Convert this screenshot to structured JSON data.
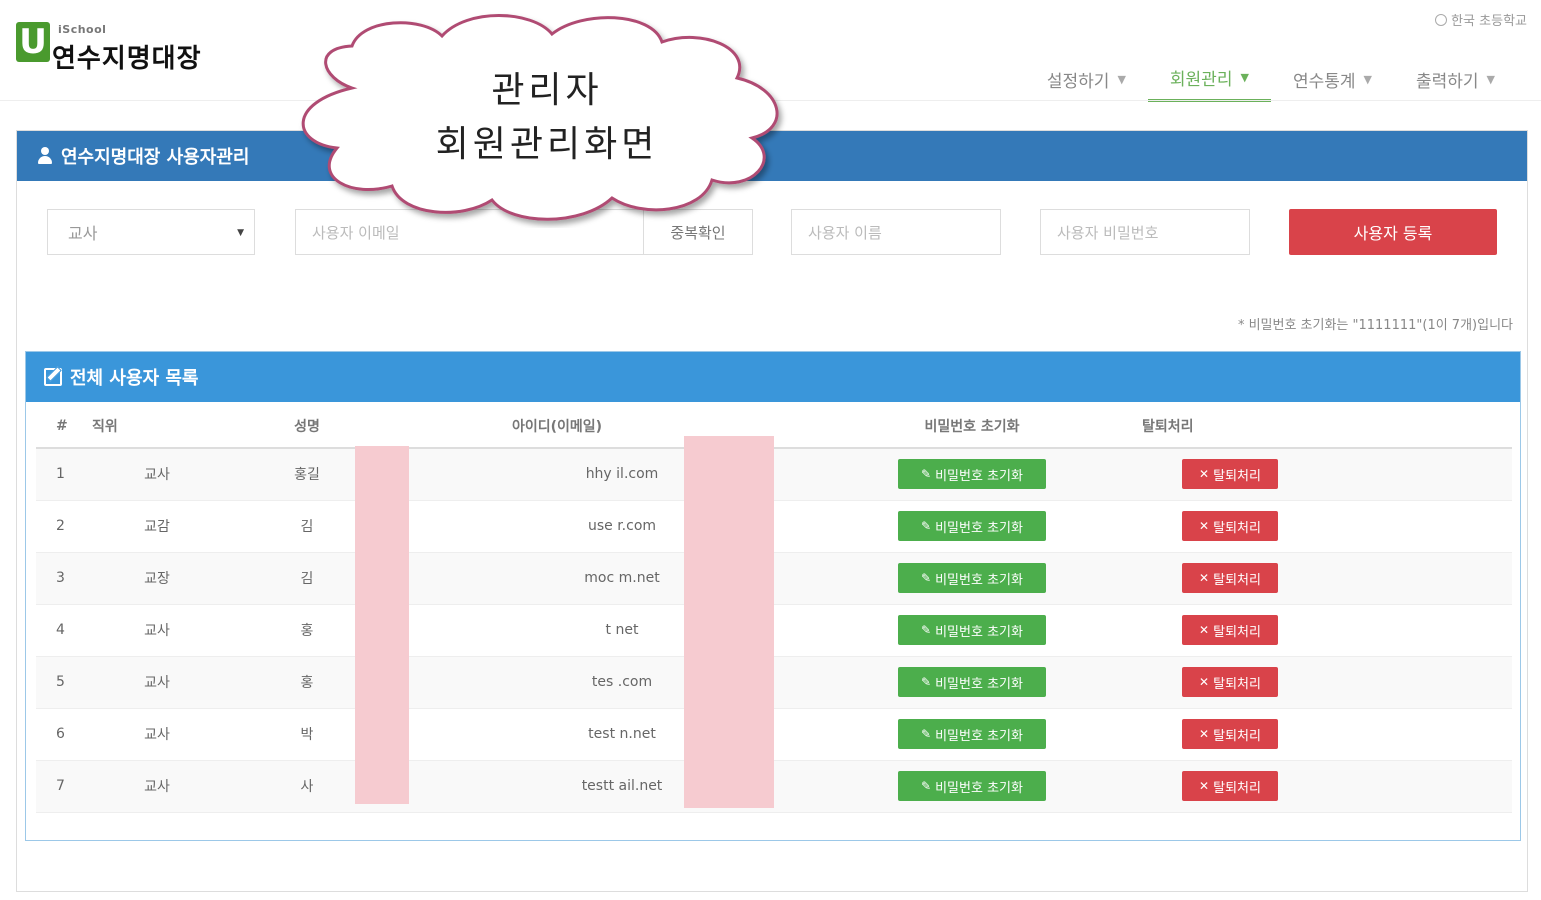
{
  "header": {
    "logo_small": "iSchool",
    "logo_letter": "U",
    "logo_title": "연수지명대장",
    "school_name": "한국 초등학교",
    "nav": [
      {
        "label": "설정하기",
        "active": false
      },
      {
        "label": "회원관리",
        "active": true
      },
      {
        "label": "연수통계",
        "active": false
      },
      {
        "label": "출력하기",
        "active": false
      }
    ]
  },
  "callout": {
    "line1": "관리자",
    "line2": "회원관리화면"
  },
  "user_panel": {
    "title": "연수지명대장 사용자관리",
    "position_select": "교사",
    "email_placeholder": "사용자 이메일",
    "dup_check_label": "중복확인",
    "name_placeholder": "사용자 이름",
    "password_placeholder": "사용자 비밀번호",
    "register_label": "사용자 등록",
    "note": "* 비밀번호 초기화는 \"1111111\"(1이 7개)입니다"
  },
  "list_panel": {
    "title": "전체 사용자 목록",
    "columns": {
      "num": "#",
      "position": "직위",
      "name": "성명",
      "id": "아이디(이메일)",
      "reset": "비밀번호 초기화",
      "leave": "탈퇴처리"
    },
    "reset_button_label": "비밀번호 초기화",
    "leave_button_label": "탈퇴처리",
    "rows": [
      {
        "num": "1",
        "position": "교사",
        "name": "홍길",
        "id": "hhy        il.com"
      },
      {
        "num": "2",
        "position": "교감",
        "name": "김",
        "id": "use        r.com"
      },
      {
        "num": "3",
        "position": "교장",
        "name": "김",
        "id": "moc        m.net"
      },
      {
        "num": "4",
        "position": "교사",
        "name": "홍",
        "id": "t         net"
      },
      {
        "num": "5",
        "position": "교사",
        "name": "홍",
        "id": "tes        .com"
      },
      {
        "num": "6",
        "position": "교사",
        "name": "박",
        "id": "test        n.net"
      },
      {
        "num": "7",
        "position": "교사",
        "name": "사",
        "id": "testt        ail.net"
      }
    ]
  },
  "colors": {
    "panel_blue": "#3479b8",
    "list_blue": "#3a96da",
    "green": "#4cae4c",
    "red": "#d9434a",
    "nav_active": "#6bb15b",
    "redaction": "#f6cbd0"
  }
}
